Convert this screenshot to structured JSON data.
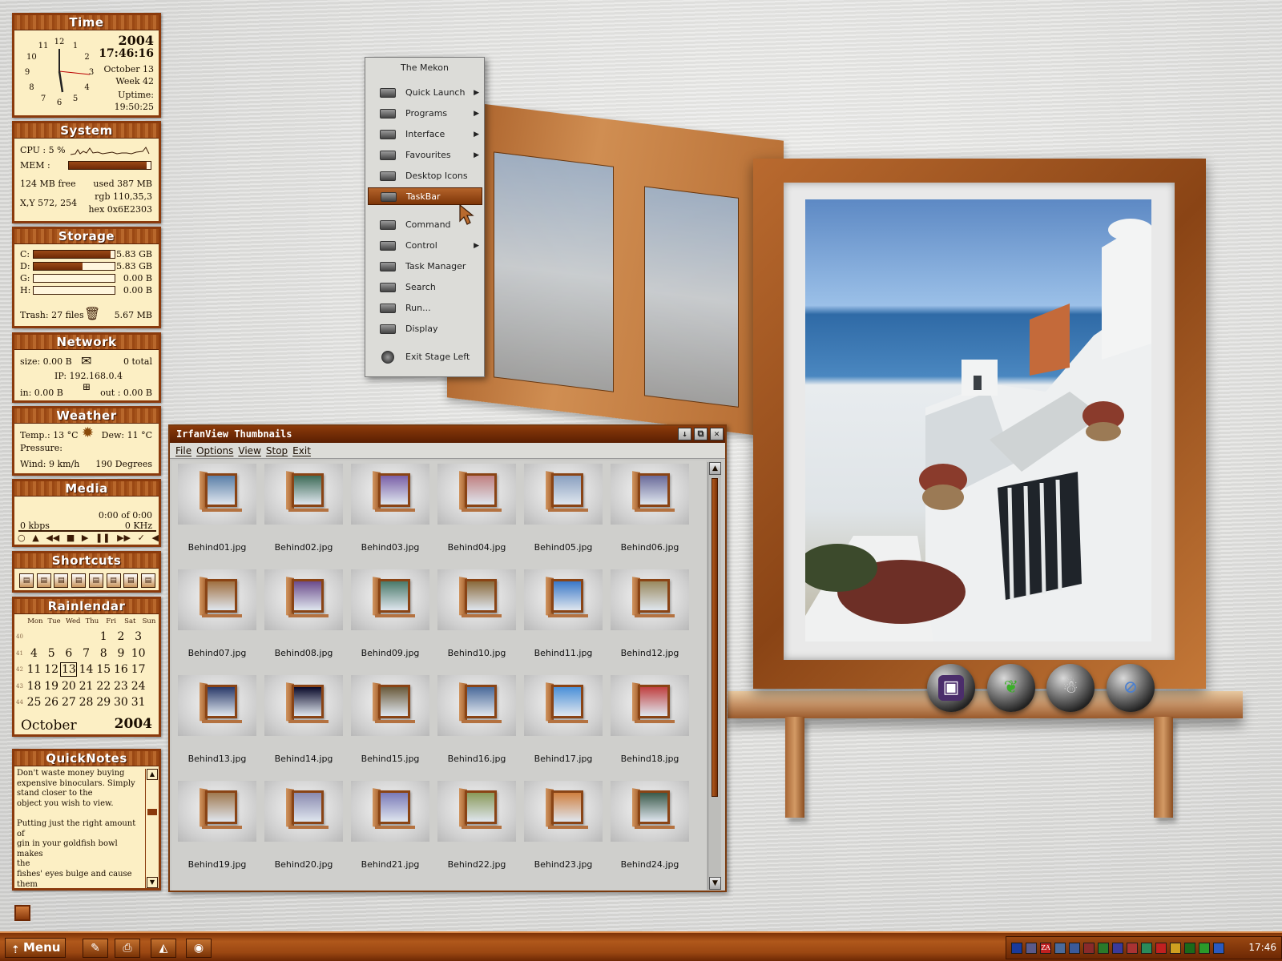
{
  "time": {
    "title": "Time",
    "year": "2004",
    "clock": "17:46:16",
    "date": "October 13",
    "week": "Week 42",
    "uptime_label": "Uptime:",
    "uptime": "19:50:25",
    "dial": [
      "12",
      "1",
      "2",
      "3",
      "4",
      "5",
      "6",
      "7",
      "8",
      "9",
      "10",
      "11"
    ]
  },
  "system": {
    "title": "System",
    "cpu": "CPU : 5 %",
    "mem": "MEM :",
    "mem_fraction": 0.95,
    "free": "124 MB free",
    "used": "used 387 MB",
    "rgb": "rgb 110,35,3",
    "xy": "X,Y  572, 254",
    "hex": "hex  0x6E2303"
  },
  "storage": {
    "title": "Storage",
    "drives": [
      {
        "label": "C:",
        "value": "5.83 GB",
        "fraction": 0.95
      },
      {
        "label": "D:",
        "value": "5.83 GB",
        "fraction": 0.6
      },
      {
        "label": "G:",
        "value": "0.00 B",
        "fraction": 0
      },
      {
        "label": "H:",
        "value": "0.00 B",
        "fraction": 0
      }
    ],
    "trash": "Trash: 27 files",
    "trash_size": "5.67 MB"
  },
  "network": {
    "title": "Network",
    "size": "size: 0.00 B",
    "total": "0 total",
    "ip": "IP: 192.168.0.4",
    "in": "in: 0.00 B",
    "out": "out : 0.00 B"
  },
  "weather": {
    "title": "Weather",
    "temp": "Temp.: 13 °C",
    "dew": "Dew: 11 °C",
    "pressure": "Pressure:",
    "wind": "Wind: 9 km/h",
    "degrees": "190 Degrees"
  },
  "media": {
    "title": "Media",
    "time": "0:00  of  0:00",
    "kbps": "0 kbps",
    "khz": "0 KHz",
    "controls": [
      "○",
      "▲",
      "◀◀",
      "■",
      "▶",
      "❚❚",
      "▶▶",
      "✓",
      "◀"
    ]
  },
  "shortcuts": {
    "title": "Shortcuts",
    "count": 8
  },
  "calendar": {
    "title": "Rainlendar",
    "days": [
      "Mon",
      "Tue",
      "Wed",
      "Thu",
      "Fri",
      "Sat",
      "Sun"
    ],
    "weeks": [
      {
        "n": "40",
        "d": [
          "",
          "",
          "",
          "",
          "1",
          "2",
          "3"
        ]
      },
      {
        "n": "41",
        "d": [
          "4",
          "5",
          "6",
          "7",
          "8",
          "9",
          "10"
        ]
      },
      {
        "n": "42",
        "d": [
          "11",
          "12",
          "13",
          "14",
          "15",
          "16",
          "17"
        ]
      },
      {
        "n": "43",
        "d": [
          "18",
          "19",
          "20",
          "21",
          "22",
          "23",
          "24"
        ]
      },
      {
        "n": "44",
        "d": [
          "25",
          "26",
          "27",
          "28",
          "29",
          "30",
          "31"
        ]
      }
    ],
    "today": "13",
    "month": "October",
    "year": "2004"
  },
  "quicknotes": {
    "title": "QuickNotes",
    "text": "Don't waste money buying\nexpensive binoculars. Simply\nstand closer to the\nobject you wish to view.\n\nPutting just the right amount of\ngin in your goldfish bowl makes\nthe\nfishes' eyes bulge and cause them\nto swim in an amusing manner."
  },
  "menu": {
    "title": "The Mekon",
    "items": [
      {
        "label": "Quick Launch",
        "sub": true
      },
      {
        "label": "Programs",
        "sub": true
      },
      {
        "label": "Interface",
        "sub": true
      },
      {
        "label": "Favourites",
        "sub": true
      },
      {
        "label": "Desktop Icons",
        "sub": false
      },
      {
        "label": "TaskBar",
        "sub": false,
        "selected": true
      },
      {
        "label": "Command",
        "sub": false
      },
      {
        "label": "Control",
        "sub": true
      },
      {
        "label": "Task Manager",
        "sub": false
      },
      {
        "label": "Search",
        "sub": false
      },
      {
        "label": "Run...",
        "sub": false
      },
      {
        "label": "Display",
        "sub": false
      },
      {
        "label": "Exit Stage Left",
        "sub": false
      }
    ]
  },
  "irfanview": {
    "title": "IrfanView Thumbnails",
    "menu": [
      "File",
      "Options",
      "View",
      "Stop",
      "Exit"
    ],
    "files": [
      "Behind01.jpg",
      "Behind02.jpg",
      "Behind03.jpg",
      "Behind04.jpg",
      "Behind05.jpg",
      "Behind06.jpg",
      "Behind07.jpg",
      "Behind08.jpg",
      "Behind09.jpg",
      "Behind10.jpg",
      "Behind11.jpg",
      "Behind12.jpg",
      "Behind13.jpg",
      "Behind14.jpg",
      "Behind15.jpg",
      "Behind16.jpg",
      "Behind17.jpg",
      "Behind18.jpg",
      "Behind19.jpg",
      "Behind20.jpg",
      "Behind21.jpg",
      "Behind22.jpg",
      "Behind23.jpg",
      "Behind24.jpg"
    ]
  },
  "taskbar": {
    "menu_label": "Menu",
    "clock": "17:46",
    "tray_icons": [
      "lock",
      "monitor",
      "ZA",
      "network",
      "folders",
      "security",
      "refresh",
      "display",
      "av",
      "volume",
      "alert",
      "warn",
      "net2",
      "green",
      "blue"
    ]
  },
  "colors": {
    "accent": "#8a3a0c",
    "widget_bg": "#fcefc4",
    "taskbar": "#9b4712",
    "menu_selected": "#b4632a"
  }
}
